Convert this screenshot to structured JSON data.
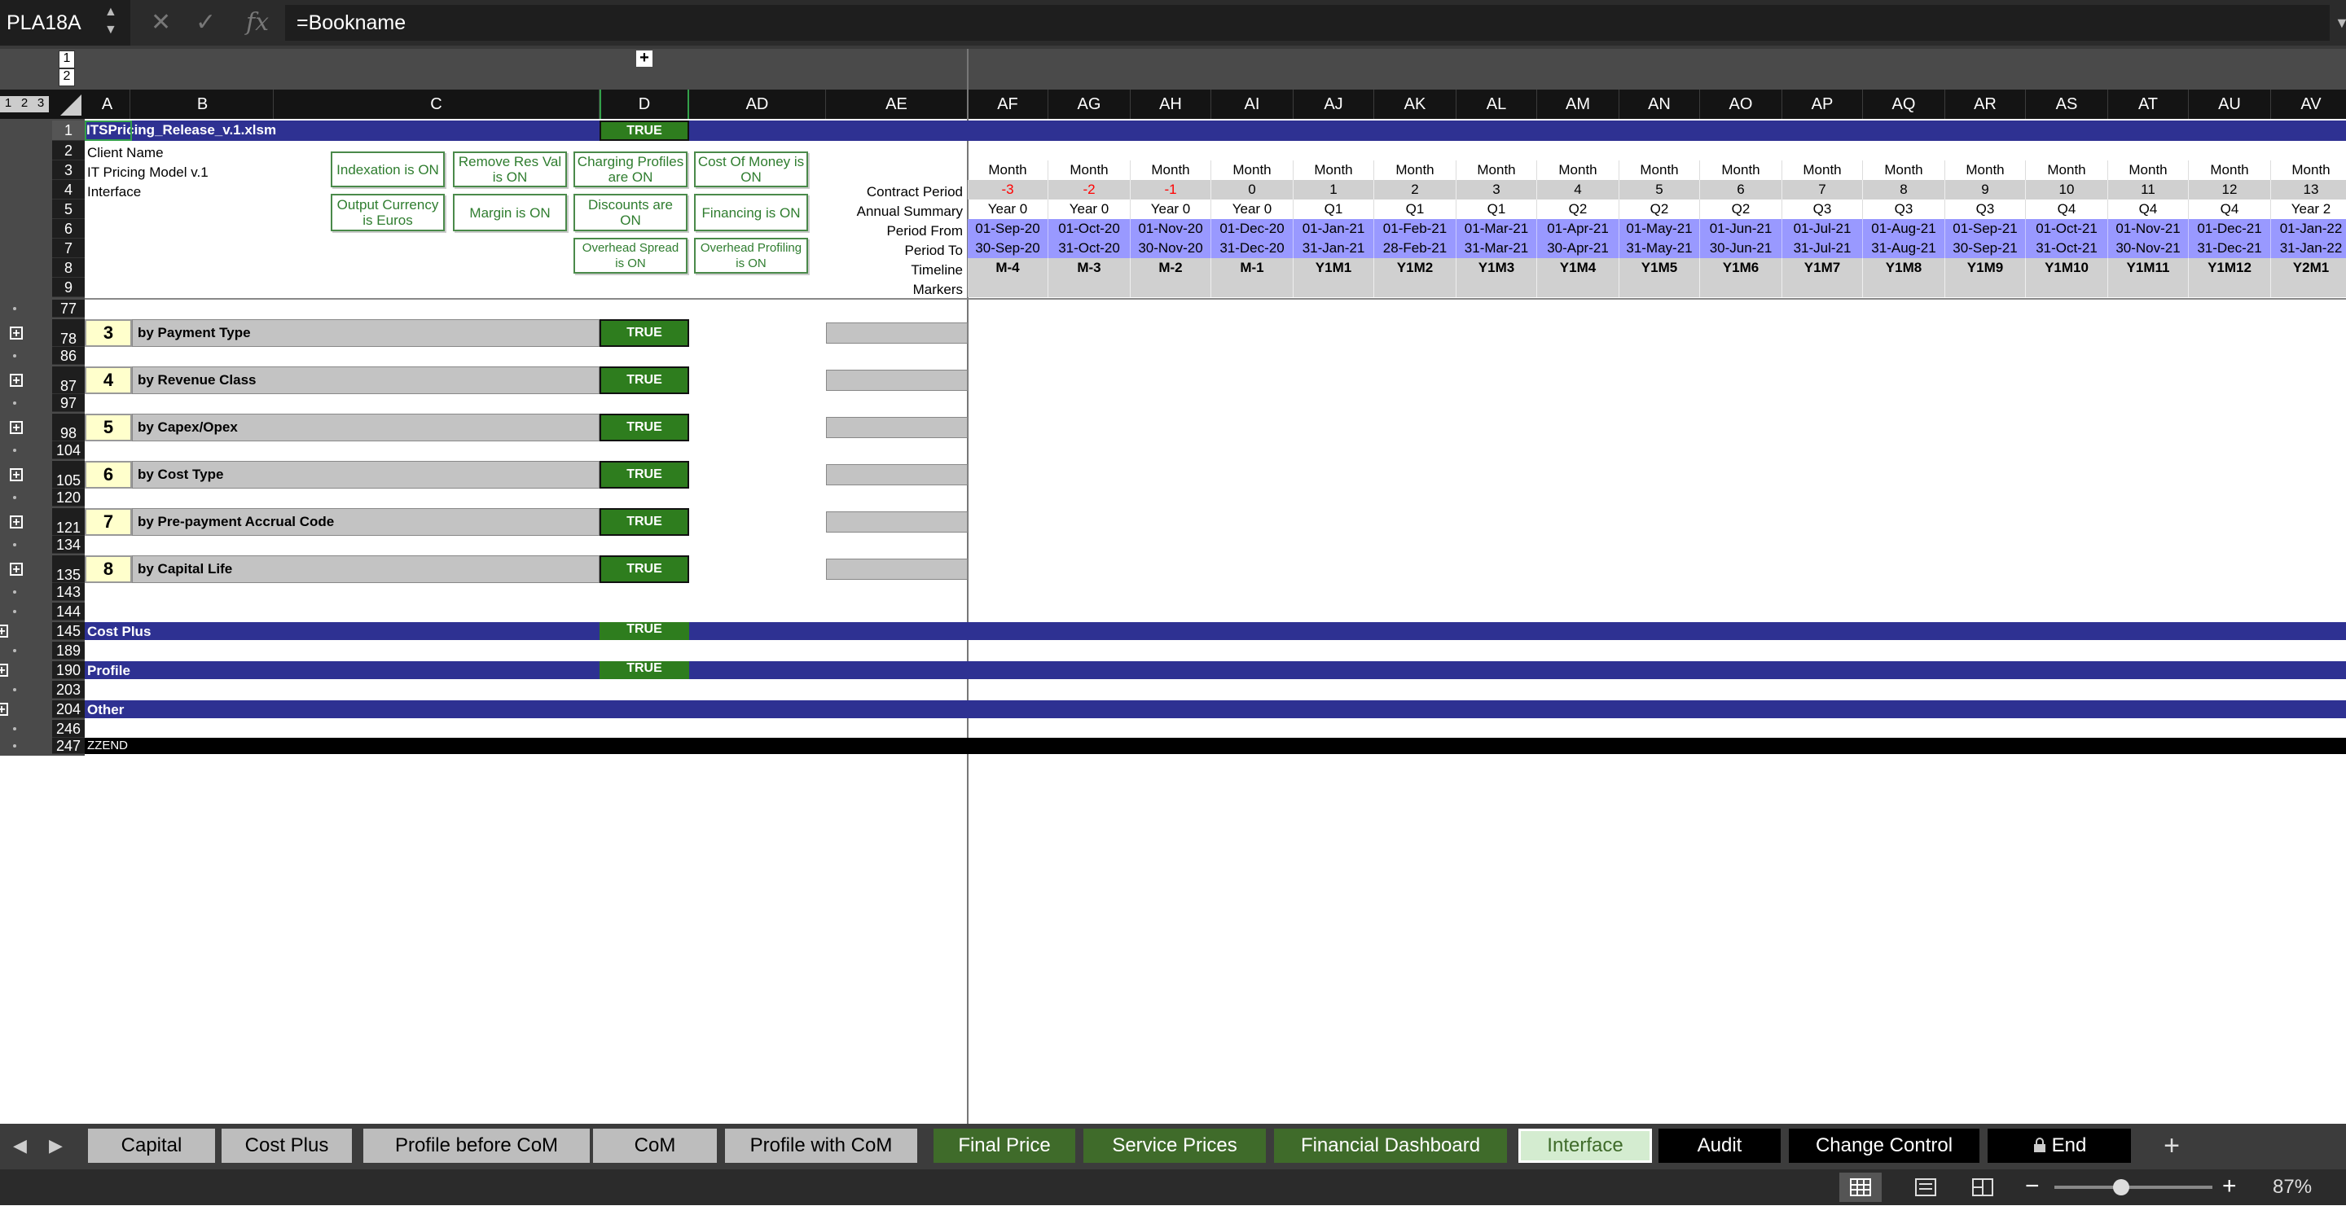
{
  "namebox": "PLA18A",
  "formula": "=Bookname",
  "icons": {
    "cancel": "✕",
    "confirm": "✓",
    "fx": "fx"
  },
  "outline_levels": [
    "1",
    "2"
  ],
  "outline_row_levels": [
    "1",
    "2",
    "3"
  ],
  "columns": [
    "A",
    "B",
    "C",
    "D",
    "AD",
    "AE",
    "AF",
    "AG",
    "AH",
    "AI",
    "AJ",
    "AK",
    "AL",
    "AM",
    "AN",
    "AO",
    "AP",
    "AQ",
    "AR",
    "AS",
    "AT",
    "AU",
    "AV"
  ],
  "rows": [
    "1",
    "2",
    "3",
    "4",
    "5",
    "6",
    "7",
    "8",
    "9",
    "77",
    "78",
    "86",
    "87",
    "97",
    "98",
    "104",
    "105",
    "120",
    "121",
    "134",
    "135",
    "143",
    "144",
    "145",
    "189",
    "190",
    "203",
    "204",
    "246",
    "247"
  ],
  "sheet": {
    "file_name": "ITSPricing_Release_v.1.xlsm",
    "true_top": "TRUE",
    "client_name": "Client Name",
    "model": "IT Pricing Model v.1",
    "interface": "Interface",
    "buttons": [
      "Indexation is ON",
      "Remove Res Val is ON",
      "Charging Profiles are ON",
      "Cost Of Money is ON",
      "Output Currency is Euros",
      "Margin is ON",
      "Discounts are ON",
      "Financing is ON",
      "Overhead Spread is ON",
      "Overhead Profiling is ON"
    ],
    "row_labels": [
      "Contract Period",
      "Annual Summary",
      "Period From",
      "Period To",
      "Timeline",
      "Markers"
    ],
    "sections": [
      {
        "num": "3",
        "label": "by Payment Type",
        "val": "TRUE"
      },
      {
        "num": "4",
        "label": "by Revenue Class",
        "val": "TRUE"
      },
      {
        "num": "5",
        "label": "by Capex/Opex",
        "val": "TRUE"
      },
      {
        "num": "6",
        "label": "by Cost Type",
        "val": "TRUE"
      },
      {
        "num": "7",
        "label": "by Pre-payment Accrual Code",
        "val": "TRUE"
      },
      {
        "num": "8",
        "label": "by Capital Life",
        "val": "TRUE"
      }
    ],
    "bars": [
      {
        "label": "Cost Plus",
        "val": "TRUE"
      },
      {
        "label": "Profile",
        "val": "TRUE"
      },
      {
        "label": "Other",
        "val": ""
      }
    ],
    "zzend": "ZZEND"
  },
  "timeline": {
    "unit": "Month",
    "contract_period": [
      "-3",
      "-2",
      "-1",
      "0",
      "1",
      "2",
      "3",
      "4",
      "5",
      "6",
      "7",
      "8",
      "9",
      "10",
      "11",
      "12",
      "13"
    ],
    "annual_summary": [
      "Year 0",
      "Year 0",
      "Year 0",
      "Year 0",
      "Q1",
      "Q1",
      "Q1",
      "Q2",
      "Q2",
      "Q2",
      "Q3",
      "Q3",
      "Q3",
      "Q4",
      "Q4",
      "Q4",
      "Year 2"
    ],
    "period_from": [
      "01-Sep-20",
      "01-Oct-20",
      "01-Nov-20",
      "01-Dec-20",
      "01-Jan-21",
      "01-Feb-21",
      "01-Mar-21",
      "01-Apr-21",
      "01-May-21",
      "01-Jun-21",
      "01-Jul-21",
      "01-Aug-21",
      "01-Sep-21",
      "01-Oct-21",
      "01-Nov-21",
      "01-Dec-21",
      "01-Jan-22"
    ],
    "period_to": [
      "30-Sep-20",
      "31-Oct-20",
      "30-Nov-20",
      "31-Dec-20",
      "31-Jan-21",
      "28-Feb-21",
      "31-Mar-21",
      "30-Apr-21",
      "31-May-21",
      "30-Jun-21",
      "31-Jul-21",
      "31-Aug-21",
      "30-Sep-21",
      "31-Oct-21",
      "30-Nov-21",
      "31-Dec-21",
      "31-Jan-22"
    ],
    "timeline": [
      "M-4",
      "M-3",
      "M-2",
      "M-1",
      "Y1M1",
      "Y1M2",
      "Y1M3",
      "Y1M4",
      "Y1M5",
      "Y1M6",
      "Y1M7",
      "Y1M8",
      "Y1M9",
      "Y1M10",
      "Y1M11",
      "Y1M12",
      "Y2M1"
    ]
  },
  "tabs": [
    {
      "label": "Capital",
      "color": "#bdbdbd"
    },
    {
      "label": "Cost Plus",
      "color": "#bdbdbd"
    },
    {
      "label": "Profile before CoM",
      "color": "#bdbdbd"
    },
    {
      "label": "CoM",
      "color": "#bdbdbd"
    },
    {
      "label": "Profile with CoM",
      "color": "#bdbdbd"
    },
    {
      "label": "Final Price",
      "color": "#3f6b2a"
    },
    {
      "label": "Service Prices",
      "color": "#3f6b2a"
    },
    {
      "label": "Financial Dashboard",
      "color": "#3f6b2a"
    },
    {
      "label": "Interface",
      "color": "#d4ecd0"
    },
    {
      "label": "Audit",
      "color": "#000000"
    },
    {
      "label": "Change Control",
      "color": "#000000"
    },
    {
      "label": "End",
      "color": "#000000"
    }
  ],
  "add_sheet": "+",
  "zoom": "87%",
  "colors": {
    "accent_bar": "#2e3192",
    "true_green": "#2e7d1e",
    "period_blue": "#9999ff",
    "negative_red": "#ff0000"
  }
}
